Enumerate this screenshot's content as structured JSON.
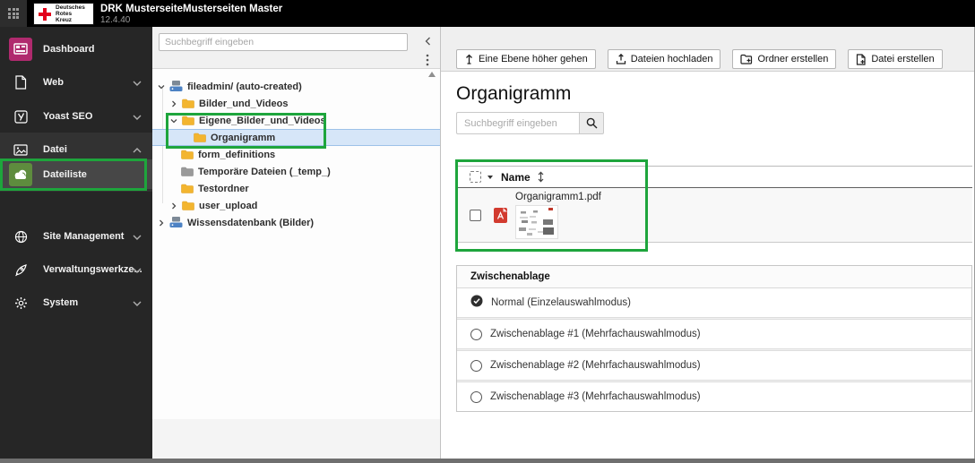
{
  "topbar": {
    "logo": {
      "lines": [
        "Deutsches",
        "Rotes",
        "Kreuz"
      ],
      "cross_color": "#e2001a"
    },
    "title": "DRK MusterseiteMusterseiten Master",
    "version": "12.4.40"
  },
  "sidebar": {
    "items": [
      {
        "label": "Dashboard",
        "icon": "dashboard-icon",
        "icon_bg": "#b02a6e"
      },
      {
        "label": "Web",
        "icon": "page-icon",
        "chevron": "down"
      },
      {
        "label": "Yoast SEO",
        "icon": "yoast-icon",
        "chevron": "down"
      },
      {
        "label": "Datei",
        "icon": "image-icon",
        "chevron": "up",
        "expanded": true
      },
      {
        "label": "Dateiliste",
        "icon": "filelist-icon",
        "icon_bg": "#5e8c3e",
        "active": true
      },
      {
        "label": "Site Management",
        "icon": "globe-icon",
        "chevron": "down"
      },
      {
        "label": "Verwaltungswerkze...",
        "icon": "rocket-icon",
        "chevron": "down"
      },
      {
        "label": "System",
        "icon": "gear-icon",
        "chevron": "down"
      }
    ]
  },
  "tree": {
    "search_placeholder": "Suchbegriff eingeben",
    "items": [
      {
        "label": "fileadmin/ (auto-created)",
        "icon": "storage-icon",
        "state": "expanded",
        "level": 0
      },
      {
        "label": "Bilder_und_Videos",
        "icon": "folder-icon",
        "state": "collapsed",
        "level": 1
      },
      {
        "label": "Eigene_Bilder_und_Videos",
        "icon": "folder-icon",
        "state": "expanded",
        "level": 1
      },
      {
        "label": "Organigramm",
        "icon": "folder-icon",
        "level": 2,
        "selected": true
      },
      {
        "label": "form_definitions",
        "icon": "folder-icon",
        "level": 1
      },
      {
        "label": "Temporäre Dateien (_temp_)",
        "icon": "folder-gray-icon",
        "level": 1
      },
      {
        "label": "Testordner",
        "icon": "folder-icon",
        "level": 1
      },
      {
        "label": "user_upload",
        "icon": "folder-icon",
        "state": "collapsed",
        "level": 1
      },
      {
        "label": "Wissensdatenbank (Bilder)",
        "icon": "storage-icon",
        "state": "collapsed",
        "level": 0
      }
    ]
  },
  "toolbar": {
    "buttons": [
      {
        "label": "Eine Ebene höher gehen",
        "icon": "level-up-icon"
      },
      {
        "label": "Dateien hochladen",
        "icon": "upload-icon"
      },
      {
        "label": "Ordner erstellen",
        "icon": "new-folder-icon"
      },
      {
        "label": "Datei erstellen",
        "icon": "new-file-icon"
      }
    ]
  },
  "main": {
    "heading": "Organigramm",
    "search_placeholder": "Suchbegriff eingeben",
    "table": {
      "name_header": "Name",
      "rows": [
        {
          "filename": "Organigramm1.pdf",
          "file_icon": "pdf-icon",
          "checked": false
        }
      ]
    },
    "clipboard": {
      "title": "Zwischenablage",
      "options": [
        {
          "label": "Normal (Einzelauswahlmodus)",
          "selected": true
        },
        {
          "label": "Zwischenablage #1 (Mehrfachauswahlmodus)",
          "selected": false
        },
        {
          "label": "Zwischenablage #2 (Mehrfachauswahlmodus)",
          "selected": false
        },
        {
          "label": "Zwischenablage #3 (Mehrfachauswahlmodus)",
          "selected": false
        }
      ]
    }
  },
  "annotations": {
    "highlight_color": "#1ea53c",
    "count": 3
  },
  "colors": {
    "topbar_bg": "#000000",
    "sidebar_bg": "#262626",
    "drk_red": "#e2001a",
    "dashboard_tile": "#b02a6e",
    "filelist_tile": "#5e8c3e",
    "folder_yellow": "#f3b52f",
    "selected_row_blue": "#d6e6f8",
    "pdf_red": "#d23b2f"
  }
}
